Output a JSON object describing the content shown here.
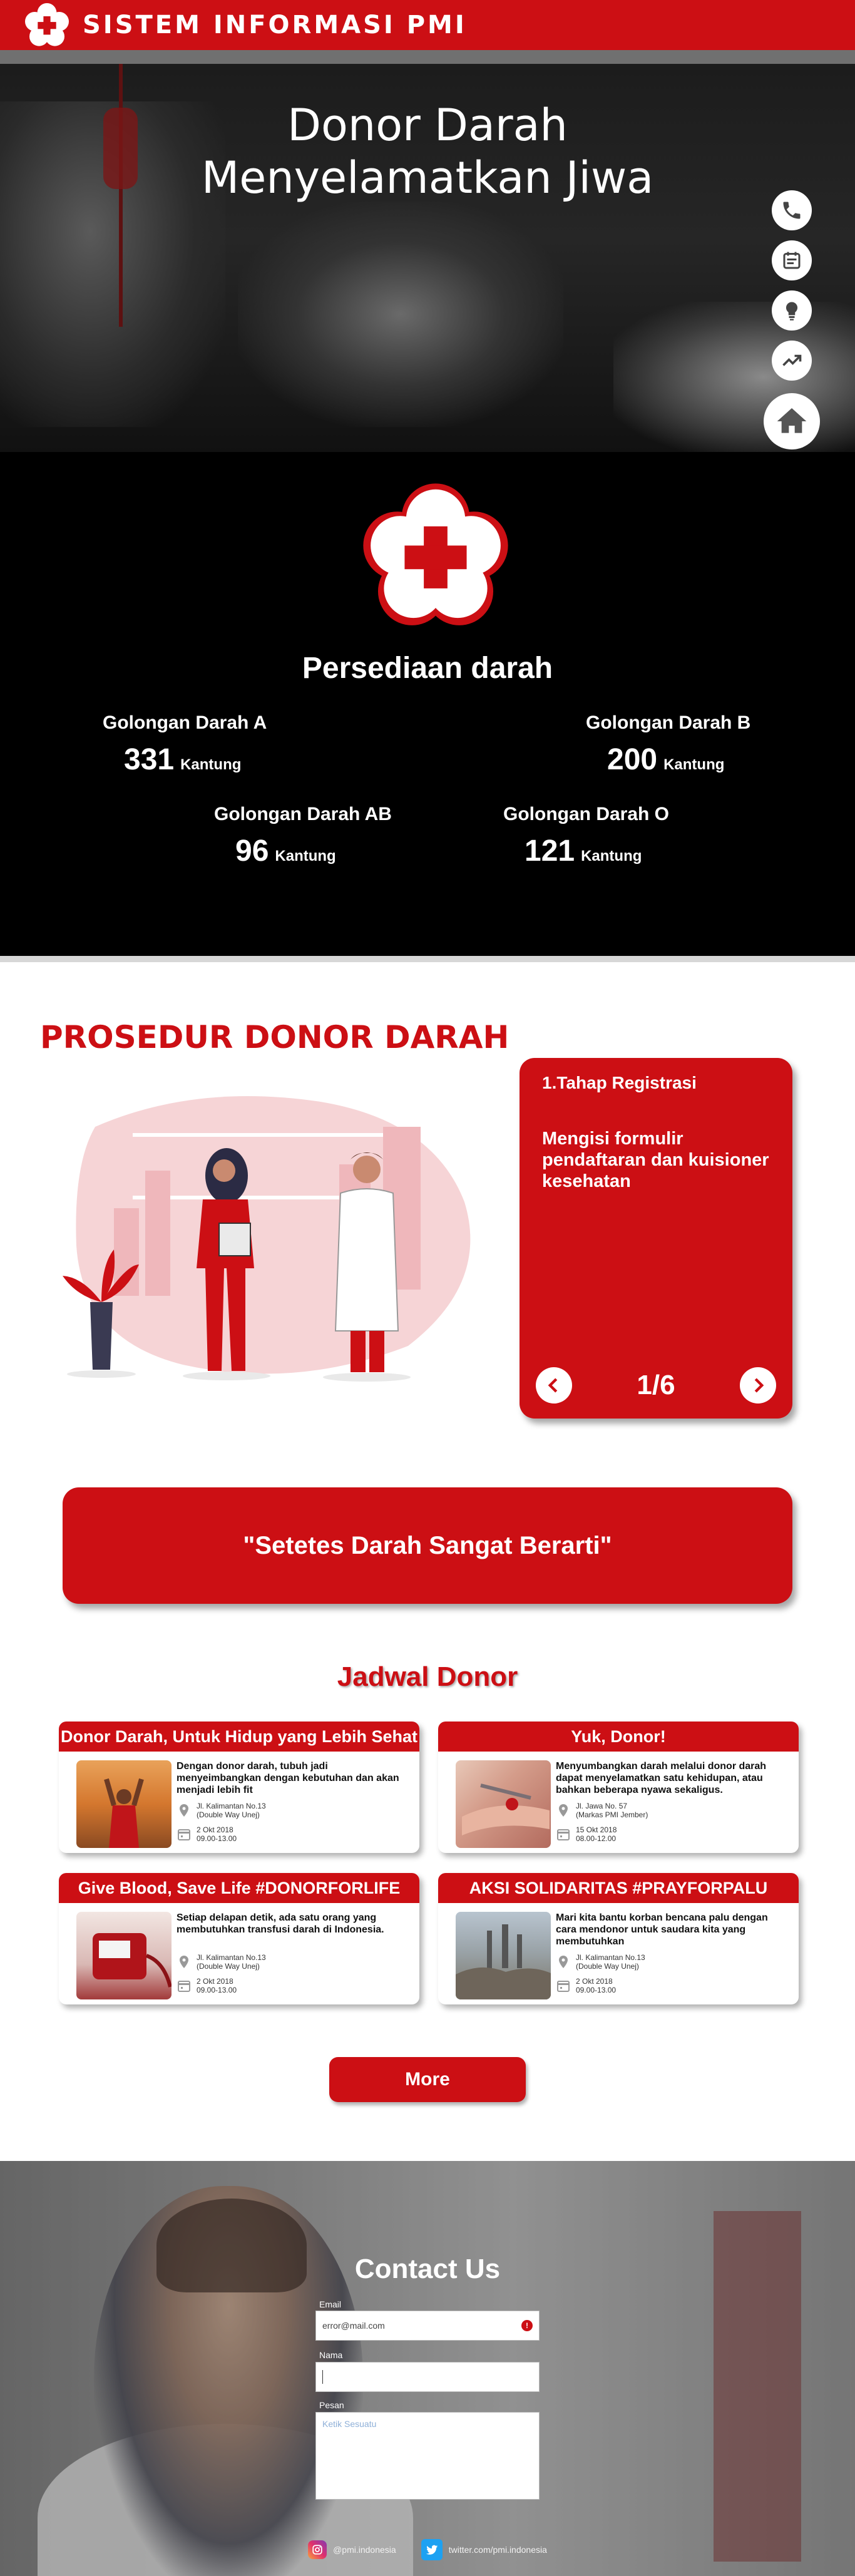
{
  "header": {
    "brand": "SISTEM INFORMASI PMI"
  },
  "hero": {
    "title_line1": "Donor Darah",
    "title_line2": "Menyelamatkan Jiwa"
  },
  "side_nav": [
    {
      "icon": "phone-icon"
    },
    {
      "icon": "calendar-icon"
    },
    {
      "icon": "lightbulb-icon"
    },
    {
      "icon": "trending-up-icon"
    },
    {
      "icon": "home-icon"
    }
  ],
  "stock": {
    "title": "Persediaan darah",
    "groups": [
      {
        "name": "Golongan Darah A",
        "value": "331",
        "unit": "Kantung"
      },
      {
        "name": "Golongan Darah B",
        "value": "200",
        "unit": "Kantung"
      },
      {
        "name": "Golongan Darah AB",
        "value": "96",
        "unit": "Kantung"
      },
      {
        "name": "Golongan Darah O",
        "value": "121",
        "unit": "Kantung"
      }
    ]
  },
  "procedure": {
    "title": "PROSEDUR DONOR DARAH",
    "step_title": "1.Tahap Registrasi",
    "step_desc": "Mengisi formulir pendaftaran dan kuisioner kesehatan",
    "pager": "1/6"
  },
  "quote": {
    "text": "\"Setetes Darah Sangat Berarti\""
  },
  "schedule": {
    "title": "Jadwal Donor",
    "events": [
      {
        "title": "Donor Darah, Untuk Hidup yang Lebih Sehat",
        "desc": "Dengan donor darah, tubuh jadi menyeimbangkan dengan kebutuhan dan akan menjadi lebih fit",
        "address1": "Jl. Kalimantan No.13",
        "address2": "(Double Way Unej)",
        "date": "2 Okt 2018",
        "time": "09.00-13.00"
      },
      {
        "title": "Yuk, Donor!",
        "desc": "Menyumbangkan darah melalui donor darah dapat menyelamatkan satu kehidupan, atau bahkan beberapa nyawa sekaligus.",
        "address1": "Jl. Jawa No. 57",
        "address2": "(Markas PMI Jember)",
        "date": "15 Okt 2018",
        "time": "08.00-12.00"
      },
      {
        "title": "Give Blood, Save Life #DONORFORLIFE",
        "desc": "Setiap delapan detik, ada satu orang yang membutuhkan transfusi darah di Indonesia.",
        "address1": "Jl. Kalimantan No.13",
        "address2": "(Double Way Unej)",
        "date": "2 Okt 2018",
        "time": "09.00-13.00"
      },
      {
        "title": "AKSI SOLIDARITAS #PRAYFORPALU",
        "desc": "Mari kita bantu korban bencana palu dengan cara mendonor untuk saudara kita yang membutuhkan",
        "address1": "Jl. Kalimantan No.13",
        "address2": "(Double Way Unej)",
        "date": "2 Okt 2018",
        "time": "09.00-13.00"
      }
    ],
    "more_label": "More"
  },
  "contact": {
    "title": "Contact Us",
    "email_label": "Email",
    "email_value": "error@mail.com",
    "name_label": "Nama",
    "message_label": "Pesan",
    "message_placeholder": "Ketik Sesuatu",
    "instagram": "@pmi.indonesia",
    "twitter": "twitter.com/pmi.indonesia"
  },
  "colors": {
    "primary": "#cc0f14",
    "dark": "#000000",
    "white": "#ffffff"
  }
}
